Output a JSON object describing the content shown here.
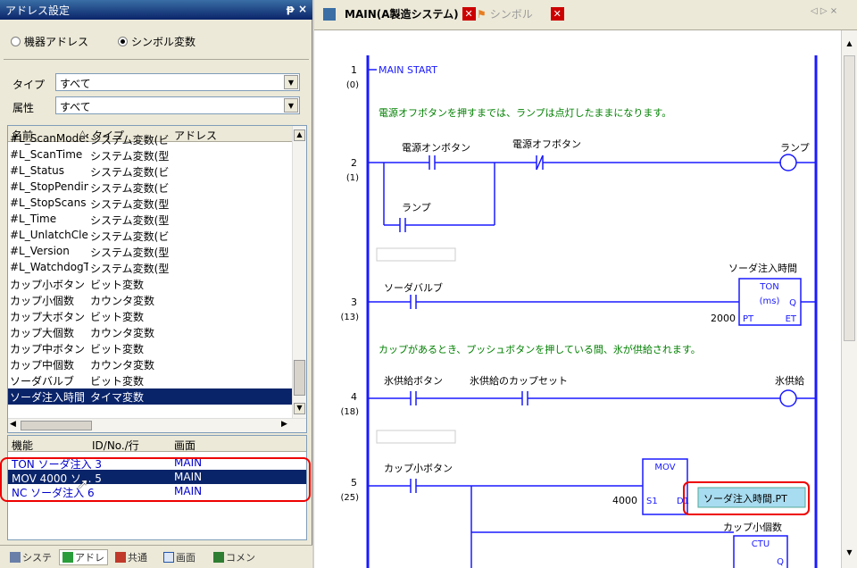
{
  "left_panel": {
    "title": "アドレス設定",
    "title_buttons": "ᵽ ×",
    "radio_device": "機器アドレス",
    "radio_symbol": "シンボル変数",
    "type_label": "タイプ",
    "type_value": "すべて",
    "attr_label": "属性",
    "attr_value": "すべて",
    "list_headers": [
      "名前",
      "タイプ",
      "アドレス"
    ],
    "list_rows": [
      [
        "#L_ScanModeS",
        "システム変数(ビ"
      ],
      [
        "#L_ScanTime",
        "システム変数(型"
      ],
      [
        "#L_Status",
        "システム変数(ビ"
      ],
      [
        "#L_StopPending",
        "システム変数(ビ"
      ],
      [
        "#L_StopScans",
        "システム変数(型"
      ],
      [
        "#L_Time",
        "システム変数(型"
      ],
      [
        "#L_UnlatchClea",
        "システム変数(ビ"
      ],
      [
        "#L_Version",
        "システム変数(型"
      ],
      [
        "#L_WatchdogTi",
        "システム変数(型"
      ],
      [
        "カップ小ボタン",
        "ビット変数"
      ],
      [
        "カップ小個数",
        "カウンタ変数"
      ],
      [
        "カップ大ボタン",
        "ビット変数"
      ],
      [
        "カップ大個数",
        "カウンタ変数"
      ],
      [
        "カップ中ボタン",
        "ビット変数"
      ],
      [
        "カップ中個数",
        "カウンタ変数"
      ],
      [
        "ソーダバルブ",
        "ビット変数"
      ],
      [
        "ソーダ注入時間",
        "タイマ変数"
      ]
    ],
    "func_headers": [
      "機能",
      "ID/No./行",
      "画面"
    ],
    "func_rows": [
      [
        "TON ソーダ注入 3",
        "MAIN"
      ],
      [
        "MOV 4000 ソ... 5",
        "MAIN"
      ],
      [
        "NC ソーダ注入 6",
        "MAIN"
      ]
    ],
    "bottom_tabs": [
      "システ",
      "アドレ",
      "共通",
      "画面",
      "コメン"
    ]
  },
  "right_panel": {
    "tab_main": "MAIN(A製造システム)",
    "tab_symbol": "シンボル",
    "nav": "◁ ▷ ×",
    "rungs": [
      {
        "num": "1",
        "step": "(0)",
        "text": "MAIN START"
      },
      {
        "num": "2",
        "step": "(1)"
      },
      {
        "num": "3",
        "step": "(13)"
      },
      {
        "num": "4",
        "step": "(18)"
      },
      {
        "num": "5",
        "step": "(25)"
      }
    ],
    "comment1": "電源オフボタンを押すまでは、ランプは点灯したままになります。",
    "comment2": "カップがあるとき、プッシュボタンを押している間、氷が供給されます。",
    "power_on": "電源オンボタン",
    "power_off": "電源オフボタン",
    "lamp": "ランプ",
    "lamp_contact": "ランプ",
    "soda_valve": "ソーダバルブ",
    "soda_timer": "ソーダ注入時間",
    "ton": "TON",
    "ms": "(ms)",
    "q": "Q",
    "pt": "PT",
    "et": "ET",
    "pt_value": "2000",
    "ice_button": "氷供給ボタン",
    "ice_cupset": "氷供給のカップセット",
    "ice_supply": "氷供給",
    "cup_small_button": "カップ小ボタン",
    "mov": "MOV",
    "mov_value": "4000",
    "s1": "S1",
    "d1": "D1",
    "mov_dest": "ソーダ注入時間.PT",
    "cup_small_count": "カップ小個数",
    "ctu": "CTU",
    "ctu_q": "Q"
  }
}
